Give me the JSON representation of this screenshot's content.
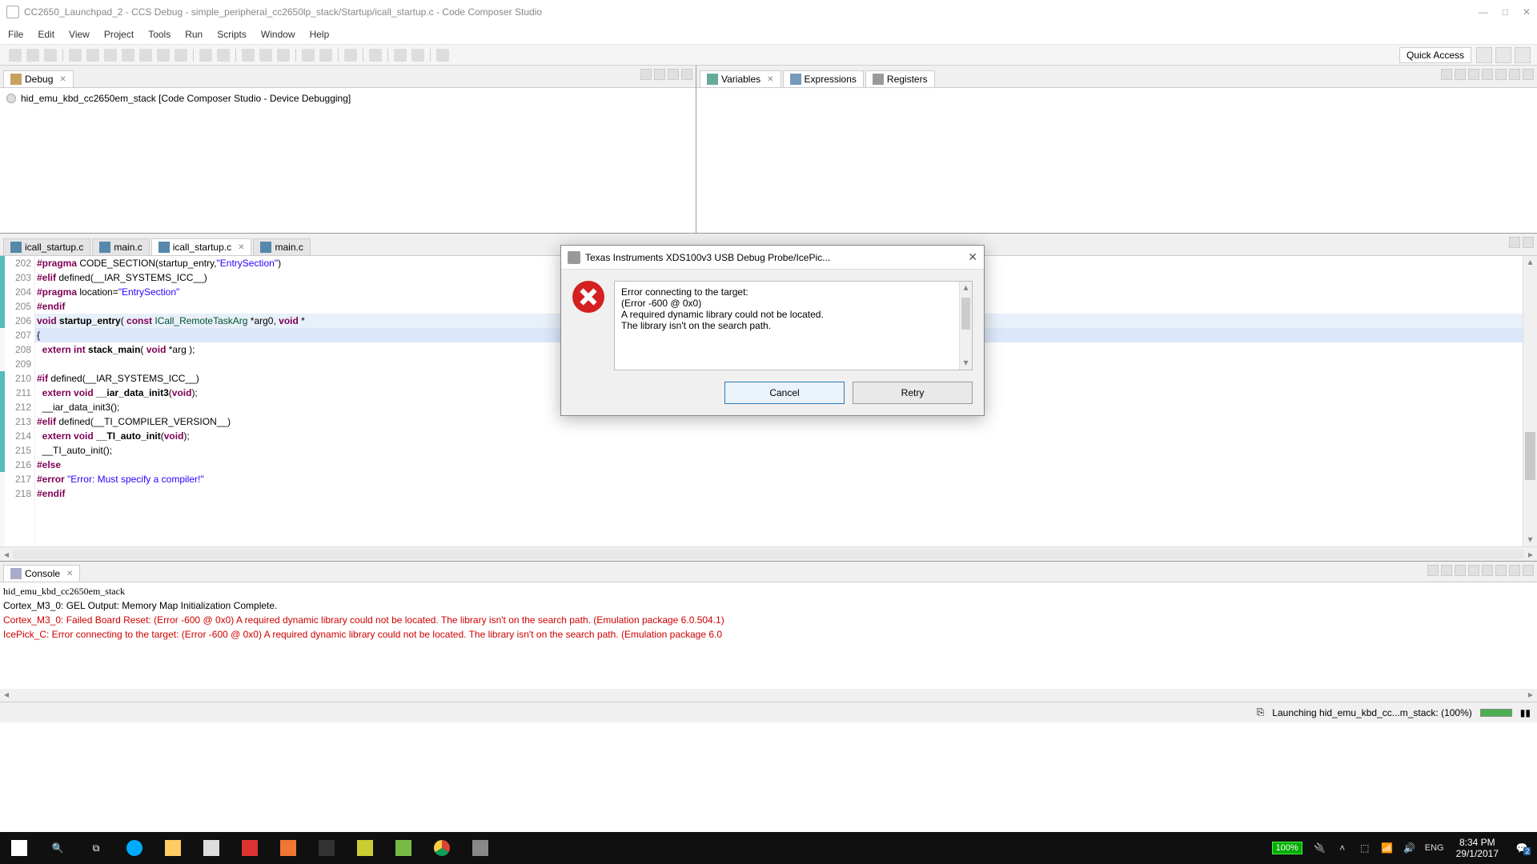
{
  "window": {
    "title": "CC2650_Launchpad_2 - CCS Debug - simple_peripheral_cc2650lp_stack/Startup/icall_startup.c - Code Composer Studio",
    "min": "—",
    "max": "□",
    "close": "✕"
  },
  "menubar": [
    "File",
    "Edit",
    "View",
    "Project",
    "Tools",
    "Run",
    "Scripts",
    "Window",
    "Help"
  ],
  "quick_access": "Quick Access",
  "debug": {
    "tab_label": "Debug",
    "item": "hid_emu_kbd_cc2650em_stack [Code Composer Studio - Device Debugging]"
  },
  "vars": {
    "tab_variables": "Variables",
    "tab_expressions": "Expressions",
    "tab_registers": "Registers"
  },
  "editor": {
    "tabs": [
      {
        "label": "icall_startup.c"
      },
      {
        "label": "main.c"
      },
      {
        "label": "icall_startup.c",
        "active": true
      },
      {
        "label": "main.c"
      }
    ],
    "lines": [
      {
        "n": 202,
        "html": "<span class='kw'>#pragma</span> CODE_SECTION(startup_entry,<span class='str'>\"EntrySection\"</span>)"
      },
      {
        "n": 203,
        "html": "<span class='kw'>#elif</span> defined(__IAR_SYSTEMS_ICC__)"
      },
      {
        "n": 204,
        "html": "<span class='kw'>#pragma</span> location=<span class='str'>\"EntrySection\"</span>"
      },
      {
        "n": 205,
        "html": "<span class='kw'>#endif</span>"
      },
      {
        "n": 206,
        "html": "<span class='kw'>void</span> <span class='func'>startup_entry</span>( <span class='kw'>const</span> <span class='type'>ICall_RemoteTaskArg</span> *arg0, <span class='kw'>void</span> *",
        "hl": true
      },
      {
        "n": 207,
        "html": "{",
        "active": true
      },
      {
        "n": 208,
        "html": "  <span class='kw'>extern int</span> <span class='func'>stack_main</span>( <span class='kw'>void</span> *arg );"
      },
      {
        "n": 209,
        "html": ""
      },
      {
        "n": 210,
        "html": "<span class='kw'>#if</span> defined(__IAR_SYSTEMS_ICC__)"
      },
      {
        "n": 211,
        "html": "  <span class='kw'>extern void</span> <span class='func'>__iar_data_init3</span>(<span class='kw'>void</span>);"
      },
      {
        "n": 212,
        "html": "  __iar_data_init3();"
      },
      {
        "n": 213,
        "html": "<span class='kw'>#elif</span> defined(__TI_COMPILER_VERSION__)"
      },
      {
        "n": 214,
        "html": "  <span class='kw'>extern void</span> <span class='func'>__TI_auto_init</span>(<span class='kw'>void</span>);"
      },
      {
        "n": 215,
        "html": "  __TI_auto_init();"
      },
      {
        "n": 216,
        "html": "<span class='kw'>#else</span>"
      },
      {
        "n": 217,
        "html": "<span class='kw'>#error</span> <span class='str'>\"Error: Must specify a compiler!\"</span>"
      },
      {
        "n": 218,
        "html": "<span class='kw'>#endif</span>"
      }
    ]
  },
  "console": {
    "tab_label": "Console",
    "title_line": "hid_emu_kbd_cc2650em_stack",
    "lines": [
      {
        "t": "Cortex_M3_0: GEL Output: Memory Map Initialization Complete."
      },
      {
        "t": "Cortex_M3_0: Failed Board Reset: (Error -600 @ 0x0) A required dynamic library could not be located. The library isn't on the search path. (Emulation package 6.0.504.1)",
        "err": true
      },
      {
        "t": "IcePick_C: Error connecting to the target: (Error -600 @ 0x0) A required dynamic library could not be located. The library isn't on the search path. (Emulation package 6.0",
        "err": true
      }
    ]
  },
  "status": {
    "launching": "Launching hid_emu_kbd_cc...m_stack: (100%)"
  },
  "dialog": {
    "title": "Texas Instruments XDS100v3 USB Debug Probe/IcePic...",
    "msg1": "Error connecting to the target:",
    "msg2": "(Error -600 @ 0x0)",
    "msg3": "A required dynamic library could not be located.",
    "msg4": "The library isn't on the search path.",
    "cancel": "Cancel",
    "retry": "Retry"
  },
  "taskbar": {
    "battery": "100%",
    "lang": "ENG",
    "time": "8:34 PM",
    "date": "29/1/2017",
    "notif_count": "2"
  }
}
